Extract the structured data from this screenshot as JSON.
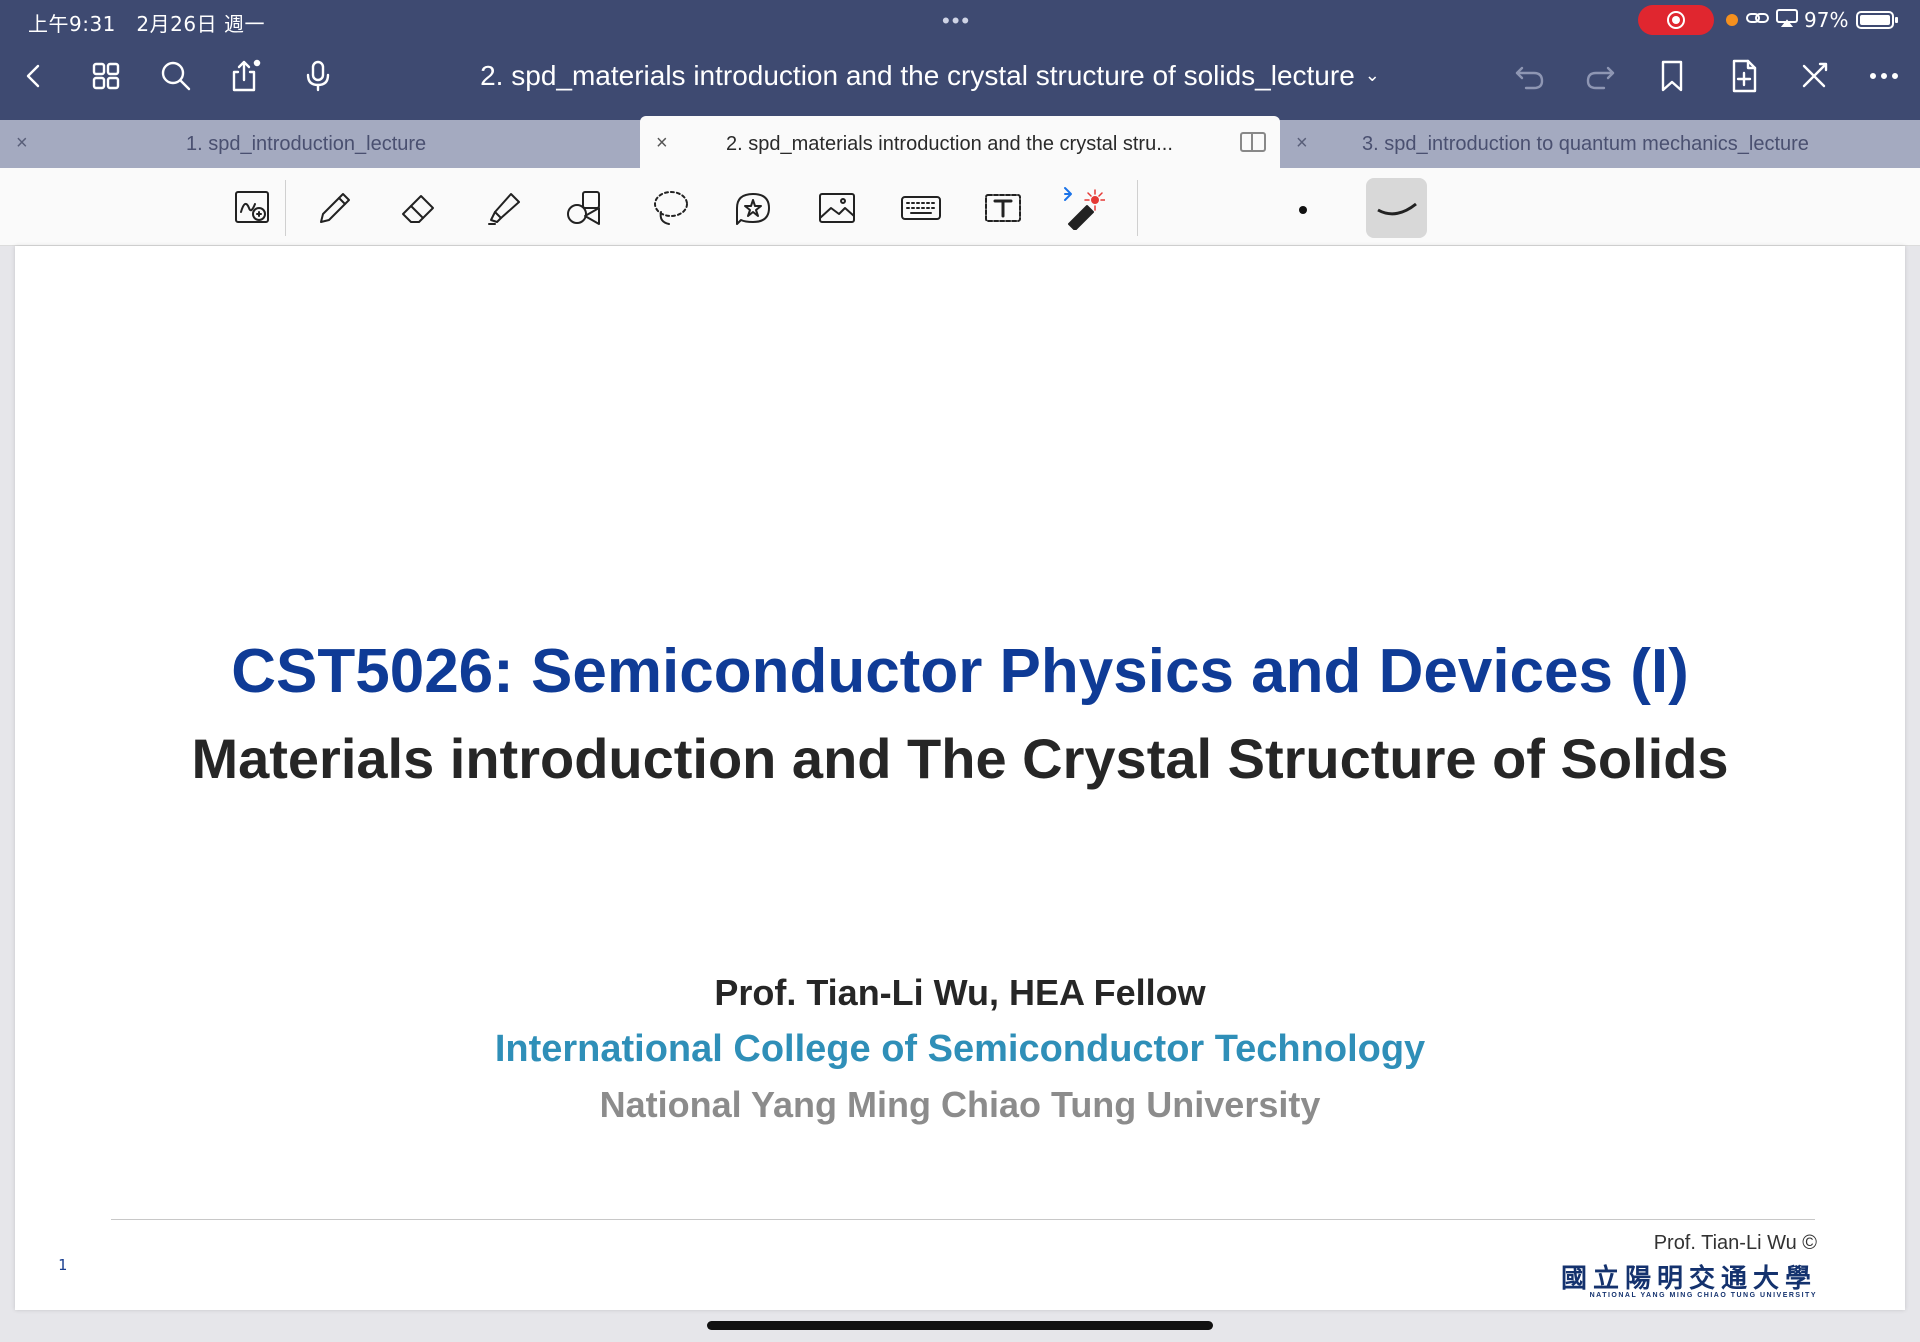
{
  "status_bar": {
    "time": "上午9:31　2月26日 週一",
    "battery": "97%"
  },
  "header": {
    "title": "2. spd_materials introduction and the crystal structure of solids_lecture",
    "title_chevron": "⌄",
    "icons": [
      "back-icon",
      "grid-icon",
      "search-icon",
      "share-icon",
      "microphone-icon",
      "undo-icon",
      "redo-icon",
      "bookmark-icon",
      "add-page-icon",
      "close-toolbar-icon",
      "more-icon"
    ]
  },
  "tabs": [
    {
      "label": "1. spd_introduction_lecture",
      "close": "×"
    },
    {
      "label": "2. spd_materials introduction and the crystal stru...",
      "close": "×"
    },
    {
      "label": "3. spd_introduction to quantum mechanics_lecture",
      "close": "×"
    }
  ],
  "tools": [
    "zoom-window-icon",
    "pen-icon",
    "eraser-icon",
    "highlighter-icon",
    "shapes-icon",
    "lasso-icon",
    "sticker-icon",
    "image-icon",
    "keyboard-icon",
    "text-box-icon",
    "laser-pointer-icon"
  ],
  "slide": {
    "title": "CST5026: Semiconductor Physics and Devices (I)",
    "subtitle": "Materials introduction and The Crystal Structure of Solids",
    "presenter": "Prof. Tian-Li Wu, HEA Fellow",
    "college": "International College of Semiconductor Technology",
    "university": "National Yang Ming Chiao Tung University",
    "page_number": "1",
    "copyright": "Prof. Tian-Li Wu ©",
    "logo_cn": "國立陽明交通大學",
    "logo_en": "NATIONAL YANG MING CHIAO TUNG UNIVERSITY"
  },
  "colors": {
    "header_bg": "#3e4a71",
    "tab_bg": "#a4aac0",
    "title_blue": "#0f3b96",
    "college_blue": "#2f8fb8",
    "university_gray": "#8c8c8c",
    "record_red": "#e0262f"
  }
}
